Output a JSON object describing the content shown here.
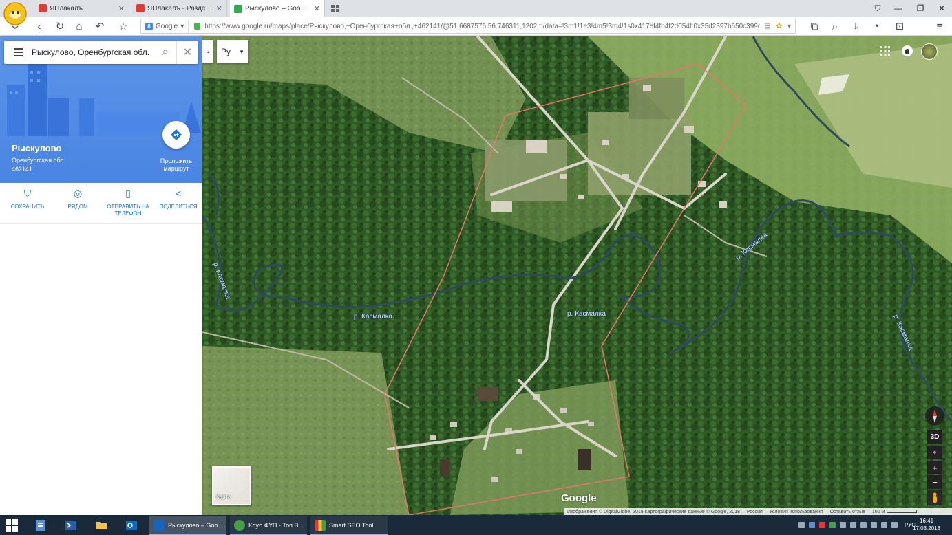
{
  "browser": {
    "tabs": [
      {
        "title": "ЯПлакалъ",
        "fav_color": "#e53935",
        "active": false
      },
      {
        "title": "ЯПлакалъ - Разделы -> ...",
        "fav_color": "#e53935",
        "active": false
      },
      {
        "title": "Рыскулово – Google К...",
        "fav_color": "#34a853",
        "active": true
      }
    ],
    "search_engine": "Google",
    "url": "https://www.google.ru/maps/place/Рыскулово,+Оренбургская+обл.,+462141/@51.6687576,56.746311,1202m/data=!3m1!1e3!4m5!3m4!1s0x417ef4fb4f2d054f:0x35d2397b650c399c!8m2!3d51.6683!4d56.7491"
  },
  "search": {
    "value": "Рыскулово, Оренбургская обл.",
    "lang": "Ру"
  },
  "place": {
    "name": "Рыскулово",
    "region": "Оренбургская обл.",
    "postcode": "462141",
    "route_label": "Проложить маршрут"
  },
  "actions": [
    {
      "label": "СОХРАНИТЬ",
      "icon": "bookmark-icon",
      "glyph": "⛉"
    },
    {
      "label": "РЯДОМ",
      "icon": "nearby-icon",
      "glyph": "◎"
    },
    {
      "label": "ОТПРАВИТЬ НА ТЕЛЕФОН",
      "icon": "send-to-phone-icon",
      "glyph": "▯"
    },
    {
      "label": "ПОДЕЛИТЬСЯ",
      "icon": "share-icon",
      "glyph": "<"
    }
  ],
  "map": {
    "rivers": [
      "р. Касмалка",
      "р. Касмалка",
      "р. Касмалка",
      "р. Касмалка",
      "р. Касмалка"
    ],
    "brand": "Google",
    "minimap_label": "Карта",
    "controls": {
      "three_d": "3D",
      "zoom_in": "+",
      "zoom_out": "−"
    },
    "attribution": [
      "Изображения © DigitalGlobe, 2018,Картографические данные © Google, 2018",
      "Россия",
      "Условия использования",
      "Оставить отзыв",
      "100 м"
    ]
  },
  "taskbar": {
    "apps": [
      {
        "label": "Рыскулово – Goo...",
        "color": "#1565c0",
        "active": true
      },
      {
        "label": "Клуб ФУП - Топ В...",
        "color": "#43a047",
        "active": false
      },
      {
        "label": "Smart SEO Tool",
        "color": "#fbc02d",
        "active": false
      }
    ],
    "lang": "РУС",
    "time": "16:41",
    "date": "17.03.2018"
  },
  "colors": {
    "accent": "#4a85e4",
    "action_blue": "#1a73e8",
    "boundary": "#e8756a",
    "river": "#2e4a5c"
  }
}
